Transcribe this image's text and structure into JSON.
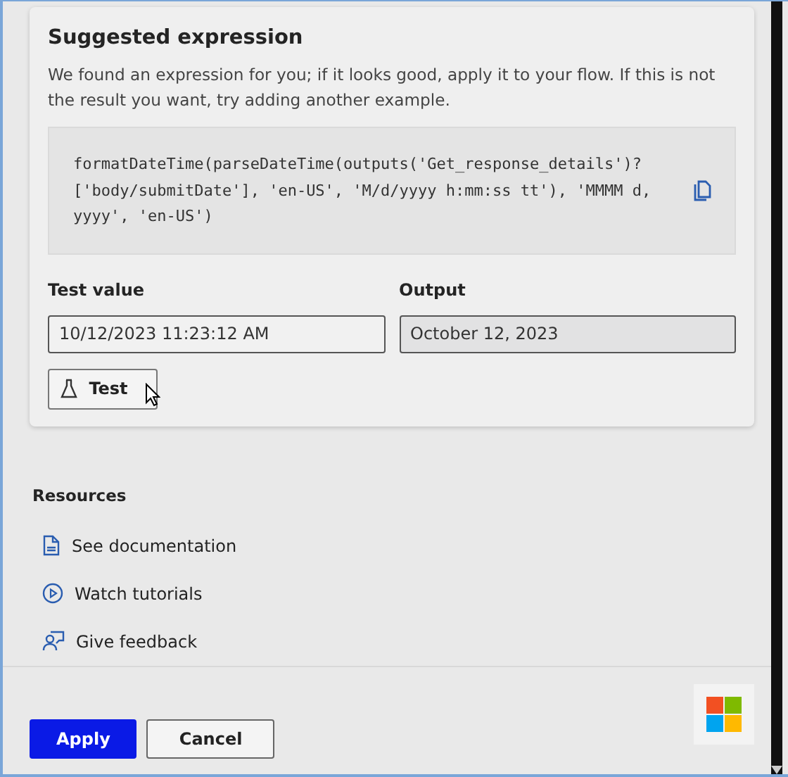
{
  "suggestion": {
    "title": "Suggested expression",
    "description": "We found an expression for you; if it looks good, apply it to your flow. If this is not the result you want, try adding another example.",
    "expression_lines": [
      "formatDateTime(parseDateTime(outputs('Get_response_details')?",
      "['body/submitDate'], 'en-US', 'M/d/yyyy h:mm:ss tt'), 'MMMM d,",
      "yyyy', 'en-US')"
    ],
    "fields": [
      {
        "label": "Test value",
        "value": "10/12/2023 11:23:12 AM",
        "disabled": false
      },
      {
        "label": "Output",
        "value": "October 12, 2023",
        "disabled": true
      }
    ],
    "test_button": "Test"
  },
  "resources": {
    "title": "Resources",
    "items": [
      {
        "kind": "document",
        "label": "See documentation"
      },
      {
        "kind": "video",
        "label": "Watch tutorials"
      },
      {
        "kind": "feedback",
        "label": "Give feedback"
      }
    ]
  },
  "footer_buttons": [
    {
      "label": "Apply",
      "kind": "primary"
    },
    {
      "label": "Cancel",
      "kind": "secondary"
    }
  ]
}
